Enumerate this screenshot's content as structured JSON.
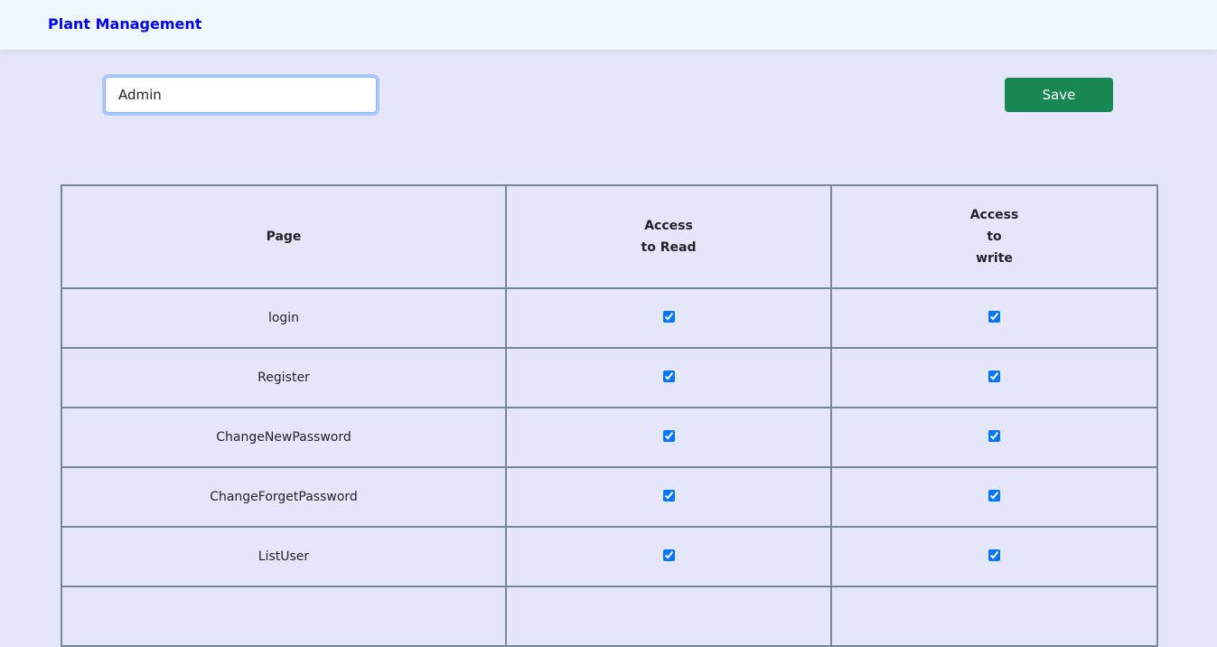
{
  "navbar": {
    "brand": "Plant Management"
  },
  "form": {
    "role_value": "Admin",
    "save_label": "Save"
  },
  "table": {
    "headers": {
      "page": "Page",
      "read_line1": "Access",
      "read_line2": "to Read",
      "write_line1": "Access",
      "write_line2": "to",
      "write_line3": "write"
    },
    "rows": [
      {
        "page": "login",
        "read": true,
        "write": true
      },
      {
        "page": "Register",
        "read": true,
        "write": true
      },
      {
        "page": "ChangeNewPassword",
        "read": true,
        "write": true
      },
      {
        "page": "ChangeForgetPassword",
        "read": true,
        "write": true
      },
      {
        "page": "ListUser",
        "read": true,
        "write": true
      },
      {
        "page": "",
        "read": null,
        "write": null
      }
    ]
  },
  "colors": {
    "accent": "#0075ff",
    "save": "#198754",
    "brand": "#0000ee",
    "background": "#e6e6fa"
  }
}
